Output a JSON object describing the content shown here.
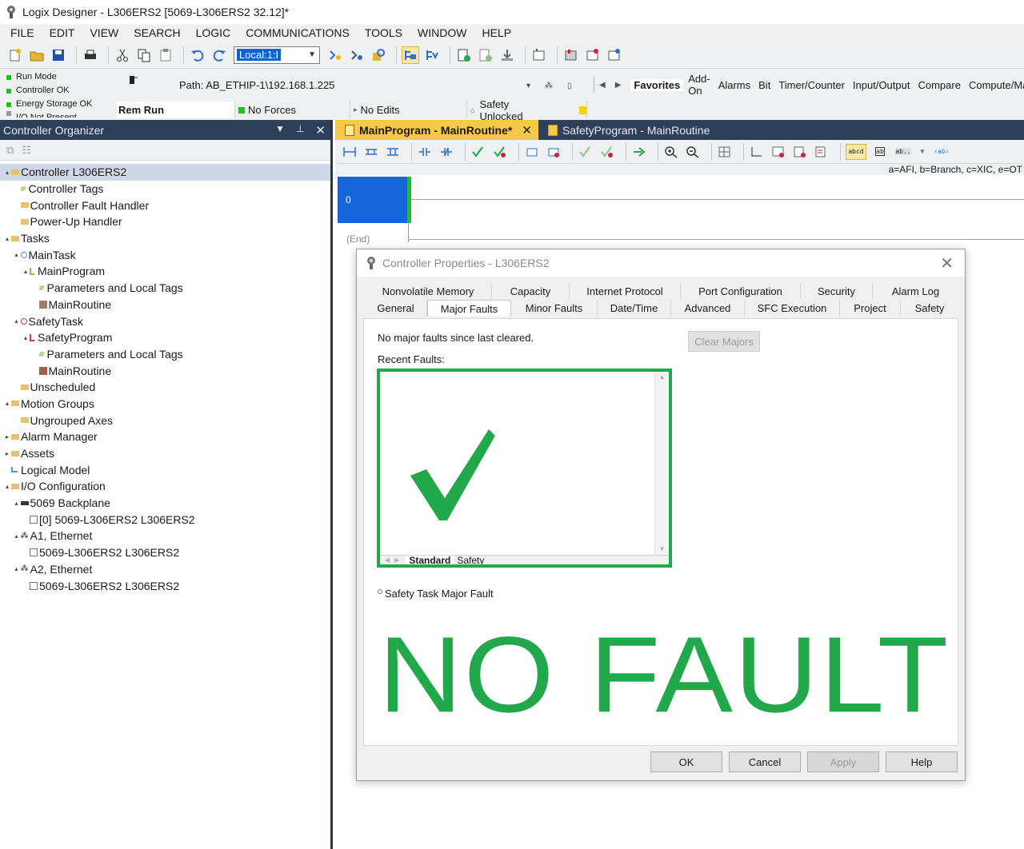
{
  "window": {
    "title": "Logix Designer - L306ERS2 [5069-L306ERS2 32.12]*"
  },
  "menu": [
    "FILE",
    "EDIT",
    "VIEW",
    "SEARCH",
    "LOGIC",
    "COMMUNICATIONS",
    "TOOLS",
    "WINDOW",
    "HELP"
  ],
  "toolbar": {
    "path_combo_value": "Local:1:I"
  },
  "status": {
    "leds": [
      {
        "label": "Run Mode",
        "color": "#21c021"
      },
      {
        "label": "Controller OK",
        "color": "#21c021"
      },
      {
        "label": "Energy Storage OK",
        "color": "#21c021"
      },
      {
        "label": "I/O Not Present",
        "color": "#9a9a9a"
      }
    ],
    "path": "Path: AB_ETHIP-1\\192.168.1.225",
    "mode": "Rem Run",
    "forces": "No Forces",
    "edits": "No Edits",
    "safety": "Safety Unlocked"
  },
  "favorites": {
    "tabs": [
      "Favorites",
      "Add-On",
      "Alarms",
      "Bit",
      "Timer/Counter",
      "Input/Output",
      "Compare",
      "Compute/Ma"
    ],
    "active": "Favorites"
  },
  "organizer": {
    "title": "Controller Organizer",
    "tree": [
      {
        "label": "Controller L306ERS2",
        "level": 0,
        "expander": "▴",
        "icon": "folder",
        "selected": true
      },
      {
        "label": "Controller Tags",
        "level": 1,
        "expander": "",
        "icon": "tag"
      },
      {
        "label": "Controller Fault Handler",
        "level": 1,
        "expander": "",
        "icon": "folder"
      },
      {
        "label": "Power-Up Handler",
        "level": 1,
        "expander": "",
        "icon": "folder"
      },
      {
        "label": "Tasks",
        "level": 0,
        "expander": "▴",
        "icon": "folder"
      },
      {
        "label": "MainTask",
        "level": 1,
        "expander": "▴",
        "icon": "task"
      },
      {
        "label": "MainProgram",
        "level": 2,
        "expander": "▴",
        "icon": "program"
      },
      {
        "label": "Parameters and Local Tags",
        "level": 3,
        "expander": "",
        "icon": "tag"
      },
      {
        "label": "MainRoutine",
        "level": 3,
        "expander": "",
        "icon": "routine"
      },
      {
        "label": "SafetyTask",
        "level": 1,
        "expander": "▴",
        "icon": "safety-task"
      },
      {
        "label": "SafetyProgram",
        "level": 2,
        "expander": "▴",
        "icon": "safety-program"
      },
      {
        "label": "Parameters and Local Tags",
        "level": 3,
        "expander": "",
        "icon": "tag"
      },
      {
        "label": "MainRoutine",
        "level": 3,
        "expander": "",
        "icon": "safety-routine"
      },
      {
        "label": "Unscheduled",
        "level": 1,
        "expander": "",
        "icon": "folder"
      },
      {
        "label": "Motion Groups",
        "level": 0,
        "expander": "▴",
        "icon": "folder"
      },
      {
        "label": "Ungrouped Axes",
        "level": 1,
        "expander": "",
        "icon": "folder"
      },
      {
        "label": "Alarm Manager",
        "level": 0,
        "expander": "▸",
        "icon": "folder"
      },
      {
        "label": "Assets",
        "level": 0,
        "expander": "▸",
        "icon": "folder"
      },
      {
        "label": "Logical Model",
        "level": 0,
        "expander": "",
        "icon": "model"
      },
      {
        "label": "I/O Configuration",
        "level": 0,
        "expander": "▴",
        "icon": "folder"
      },
      {
        "label": "5069 Backplane",
        "level": 1,
        "expander": "▴",
        "icon": "backplane"
      },
      {
        "label": "[0] 5069-L306ERS2 L306ERS2",
        "level": 2,
        "expander": "",
        "icon": "module"
      },
      {
        "label": "A1, Ethernet",
        "level": 1,
        "expander": "▴",
        "icon": "network"
      },
      {
        "label": "5069-L306ERS2 L306ERS2",
        "level": 2,
        "expander": "",
        "icon": "module"
      },
      {
        "label": "A2, Ethernet",
        "level": 1,
        "expander": "▴",
        "icon": "network"
      },
      {
        "label": "5069-L306ERS2 L306ERS2",
        "level": 2,
        "expander": "",
        "icon": "module"
      }
    ]
  },
  "editor": {
    "tabs": [
      {
        "label": "MainProgram - MainRoutine*",
        "active": true
      },
      {
        "label": "SafetyProgram - MainRoutine",
        "active": false
      }
    ],
    "instruction_hint": "a=AFI, b=Branch, c=XIC, e=OT",
    "rung_number": "0",
    "end_label": "(End)"
  },
  "dialog": {
    "title": "Controller Properties - L306ERS2",
    "tabs_row1": [
      "Nonvolatile Memory",
      "Capacity",
      "Internet Protocol",
      "Port Configuration",
      "Security",
      "Alarm Log"
    ],
    "tabs_row2": [
      "General",
      "Major Faults",
      "Minor Faults",
      "Date/Time",
      "Advanced",
      "SFC Execution",
      "Project",
      "Safety"
    ],
    "active_tab": "Major Faults",
    "no_faults_text": "No major faults since last cleared.",
    "recent_label": "Recent Faults:",
    "clear_button": "Clear Majors",
    "fault_tabs": [
      "Standard",
      "Safety"
    ],
    "safety_fault_label": "Safety Task Major Fault",
    "no_fault_banner": "NO FAULT",
    "buttons": {
      "ok": "OK",
      "cancel": "Cancel",
      "apply": "Apply",
      "help": "Help"
    },
    "accent_green": "#21a84a"
  }
}
